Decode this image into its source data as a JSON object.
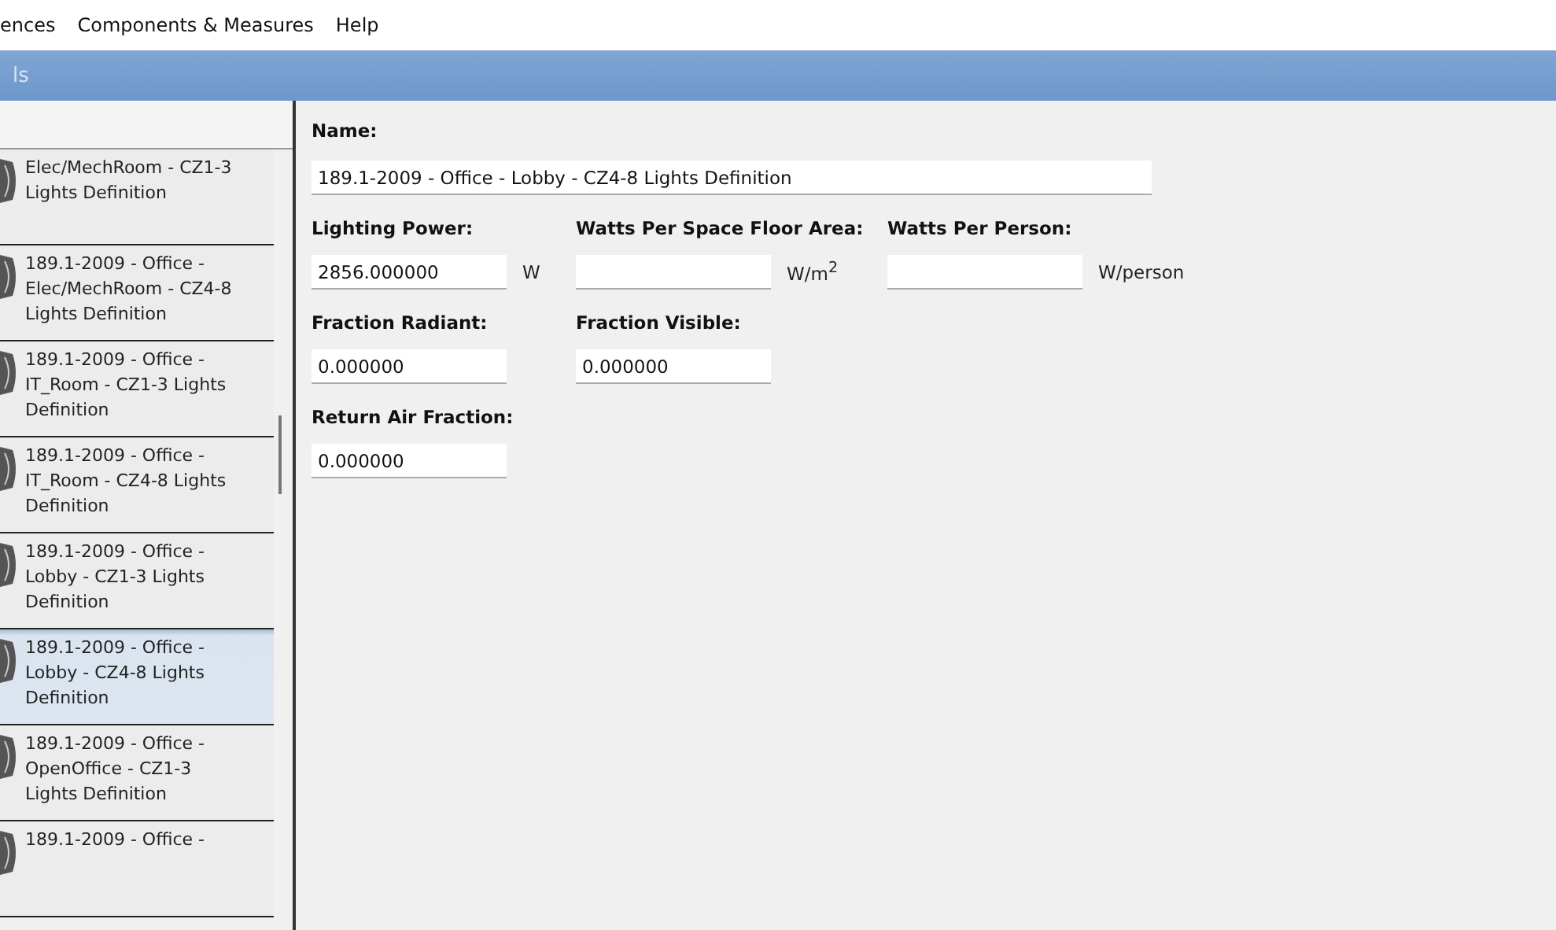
{
  "menu": [
    "ences",
    "Components & Measures",
    "Help"
  ],
  "title_bar": {
    "title": "ls"
  },
  "sidebar": {
    "items": [
      {
        "label": "Elec/MechRoom - CZ1-3 Lights Definition",
        "selected": false
      },
      {
        "label": "189.1-2009 - Office - Elec/MechRoom - CZ4-8 Lights Definition",
        "selected": false
      },
      {
        "label": "189.1-2009 - Office - IT_Room - CZ1-3 Lights Definition",
        "selected": false
      },
      {
        "label": "189.1-2009 - Office - IT_Room - CZ4-8 Lights Definition",
        "selected": false
      },
      {
        "label": "189.1-2009 - Office - Lobby - CZ1-3 Lights Definition",
        "selected": false
      },
      {
        "label": "189.1-2009 - Office - Lobby - CZ4-8 Lights Definition",
        "selected": true
      },
      {
        "label": "189.1-2009 - Office - OpenOffice - CZ1-3 Lights Definition",
        "selected": false
      },
      {
        "label": "189.1-2009 - Office -",
        "selected": false
      }
    ]
  },
  "form": {
    "name_label": "Name:",
    "name_value": "189.1-2009 - Office - Lobby - CZ4-8 Lights Definition",
    "rows": [
      [
        {
          "label": "Lighting Power:",
          "value": "2856.000000",
          "unit": "W"
        },
        {
          "label": "Watts Per Space Floor Area:",
          "unit": "W/m$^{2}$"
        },
        {
          "label": "Watts Per Person:",
          "unit": "W/person"
        }
      ],
      [
        {
          "label": "Fraction Radiant:",
          "value": "0.000000"
        },
        {
          "label": "Fraction Visible:",
          "value": "0.000000"
        }
      ],
      [
        {
          "label": "Return Air Fraction:",
          "value": "0.000000"
        }
      ]
    ]
  }
}
